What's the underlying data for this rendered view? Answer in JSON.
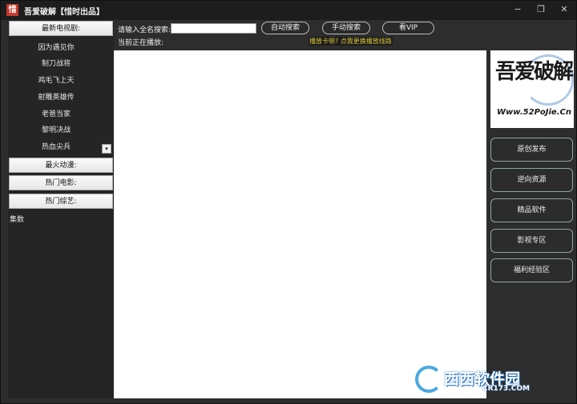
{
  "window": {
    "icon_char": "惜",
    "title": "吾爱破解【惜时出品】",
    "controls": [
      "−",
      "❐",
      "✕"
    ]
  },
  "left": {
    "categories": {
      "latest_tv": "最新电视剧:",
      "hot_anime": "最火动漫:",
      "hot_movies": "热门电影:",
      "hot_variety": "热门综艺:"
    },
    "tv_list": [
      "因为遇见你",
      "制刀战将",
      "鸡毛飞上天",
      "射雕英雄传",
      "老爸当家",
      "黎明决战",
      "热血尖兵"
    ],
    "dropdown_glyph": "▾",
    "episodes_label": "集数"
  },
  "toolbar": {
    "search_label": "请输入全名搜索:",
    "search_value": "",
    "auto_search": "自动搜索",
    "manual_search": "手动搜索",
    "vip": "看VIP",
    "now_playing": "当前正在播放:",
    "hint": "播放卡顿? 点我更换播放线路"
  },
  "logo": {
    "main": "吾爱破解",
    "sub": "Www.52PoJie.Cn"
  },
  "right_menu": [
    "原创发布",
    "逆向资源",
    "精品软件",
    "影视专区",
    "福利经验区"
  ],
  "watermark": {
    "brand": "西西软件园",
    "url": "CR173.COM"
  }
}
